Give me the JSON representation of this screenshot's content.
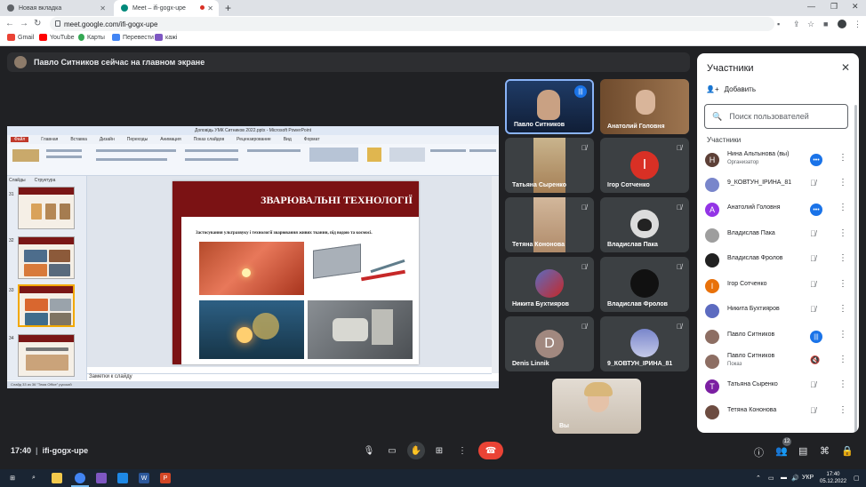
{
  "browser": {
    "tabs": [
      {
        "title": "Новая вкладка",
        "active": false
      },
      {
        "title": "Meet – ifi-gogx-upe",
        "active": true
      }
    ],
    "url": "meet.google.com/ifi-gogx-upe",
    "bookmarks": [
      "Gmail",
      "YouTube",
      "Карты",
      "Перевести",
      "кажі"
    ]
  },
  "meet": {
    "banner": "Павло Ситников сейчас на главном экране",
    "meeting_time": "17:40",
    "meeting_code": "ifi-gogx-upe",
    "participant_badge": "12",
    "tiles": [
      {
        "name": "Павло Ситников",
        "speaking": true
      },
      {
        "name": "Анатолий Головня"
      },
      {
        "name": "Татьяна Сыренко",
        "muted": true
      },
      {
        "name": "Ігор Сотченко",
        "initial": "І",
        "color": "#d93025",
        "muted": true
      },
      {
        "name": "Тетяна Кононова",
        "muted": true
      },
      {
        "name": "Владислав Пака",
        "muted": true
      },
      {
        "name": "Никита Бухтияров",
        "muted": true
      },
      {
        "name": "Владислав Фролов",
        "muted": true
      },
      {
        "name": "Denis Linnik",
        "initial": "D",
        "color": "#a1887f",
        "muted": true
      },
      {
        "name": "9_КОВТУН_ІРИНА_81",
        "muted": true
      },
      {
        "name": "Вы"
      }
    ]
  },
  "slideshow": {
    "window_title": "Доповідь УМК Ситников 2022.pptx - Microsoft PowerPoint",
    "menu": [
      "Файл",
      "Главная",
      "Вставка",
      "Дизайн",
      "Переходы",
      "Анимация",
      "Показ слайдов",
      "Рецензирование",
      "Вид",
      "Формат"
    ],
    "thumb_tabs": [
      "Слайды",
      "Структура"
    ],
    "thumb_numbers": [
      "31",
      "32",
      "33",
      "34"
    ],
    "slide_title": "ЗВАРЮВАЛЬНІ ТЕХНОЛОГІЇ",
    "slide_text": "Застосування ультразвуку і технології зварювання живих тканин, під водою та космосі.",
    "notes": "Заметки к слайду",
    "status": "Слайд 33 из 36   \"Тема Office\"   русский"
  },
  "participants_panel": {
    "title": "Участники",
    "add_label": "Добавить",
    "search_placeholder": "Поиск пользователей",
    "section": "Участники",
    "people": [
      {
        "name": "Нина Альтынова (вы)",
        "sub": "Организатор",
        "initial": "Н",
        "color": "#5d4037",
        "state": "active"
      },
      {
        "name": "9_КОВТУН_ІРИНА_81",
        "color": "#7986cb",
        "state": "muted"
      },
      {
        "name": "Анатолий Головня",
        "initial": "А",
        "color": "#9334e6",
        "state": "active"
      },
      {
        "name": "Владислав Пака",
        "color": "#9e9e9e",
        "state": "muted"
      },
      {
        "name": "Владислав Фролов",
        "color": "#212121",
        "state": "muted"
      },
      {
        "name": "Ігор Сотченко",
        "initial": "І",
        "color": "#e8710a",
        "state": "muted"
      },
      {
        "name": "Никита Бухтияров",
        "color": "#5c6bc0",
        "state": "muted"
      },
      {
        "name": "Павло Ситников",
        "color": "#8d6e63",
        "state": "speaking"
      },
      {
        "name": "Павло Ситников",
        "sub": "Показ",
        "color": "#8d6e63",
        "state": "presenting"
      },
      {
        "name": "Татьяна Сыренко",
        "initial": "Т",
        "color": "#7b1fa2",
        "state": "muted"
      },
      {
        "name": "Тетяна Кононова",
        "color": "#6d4c41",
        "state": "muted"
      }
    ]
  },
  "taskbar": {
    "lang": "УКР",
    "time": "17:40",
    "date": "05.12.2022"
  }
}
